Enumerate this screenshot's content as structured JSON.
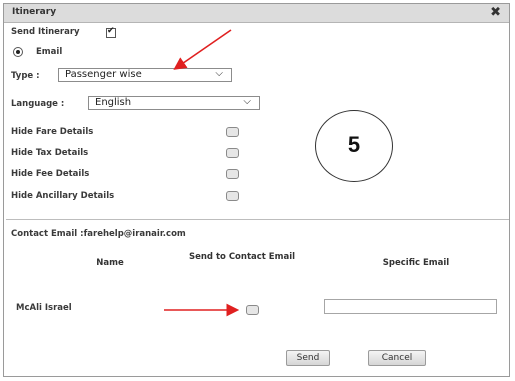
{
  "dialog": {
    "title": "Itinerary",
    "close": "✖"
  },
  "form": {
    "send_itinerary_label": "Send Itinerary",
    "email_label": "Email",
    "type_label": "Type :",
    "type_value": "Passenger wise",
    "language_label": "Language :",
    "language_value": "English",
    "hide_options": [
      "Hide Fare Details",
      "Hide Tax Details",
      "Hide Fee Details",
      "Hide Ancillary Details"
    ],
    "contact_email_text": "Contact Email :farehelp@iranair.com"
  },
  "table": {
    "headers": [
      "Name",
      "Send to Contact Email",
      "Specific Email"
    ],
    "rows": [
      {
        "name": "McAli Israel",
        "specific_email": ""
      }
    ]
  },
  "buttons": {
    "send": "Send",
    "cancel": "Cancel"
  },
  "annotation": {
    "step_number": "5",
    "arrow_color": "#e02020"
  }
}
